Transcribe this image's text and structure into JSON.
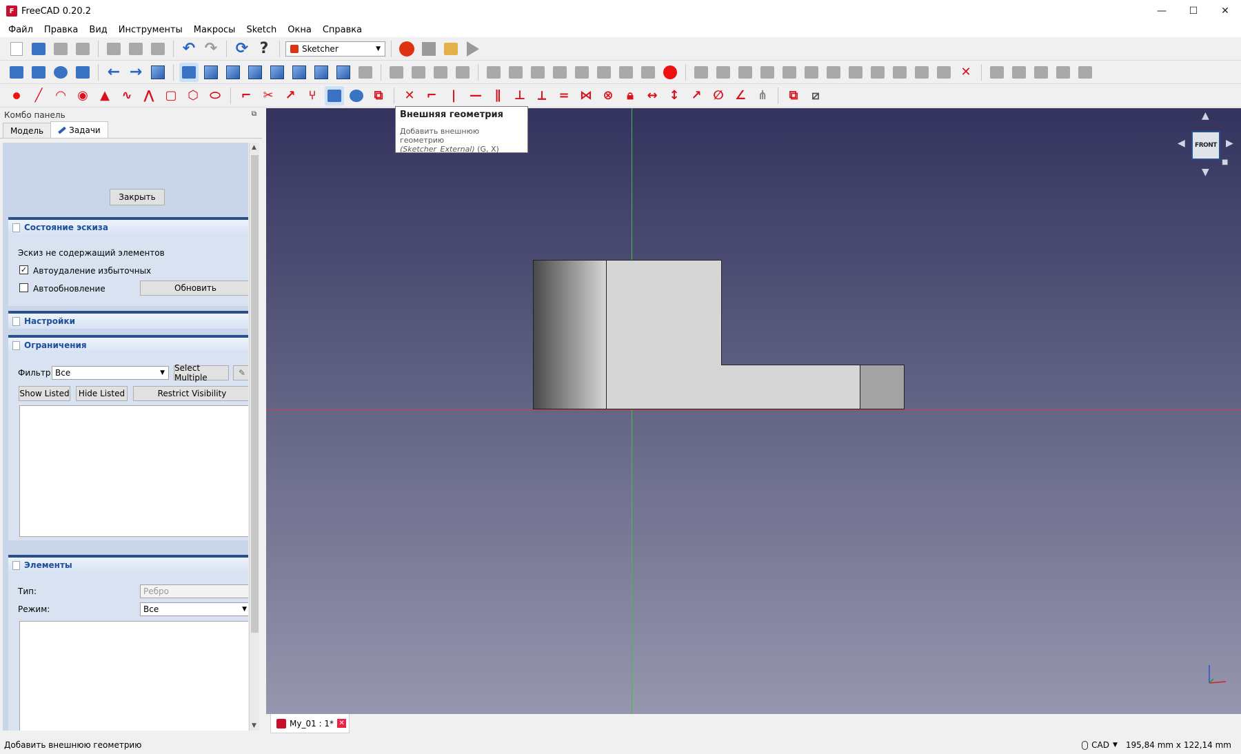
{
  "window": {
    "title": "FreeCAD 0.20.2",
    "minimize": "—",
    "maximize": "☐",
    "close": "✕"
  },
  "menu": [
    "Файл",
    "Правка",
    "Вид",
    "Инструменты",
    "Макросы",
    "Sketch",
    "Окна",
    "Справка"
  ],
  "toolbar": {
    "workbench": "Sketcher"
  },
  "combo": {
    "title": "Комбо панель",
    "tabs": [
      "Модель",
      "Задачи"
    ],
    "close_button": "Закрыть",
    "sketch_state": {
      "header": "Состояние эскиза",
      "status": "Эскиз не содержащий элементов",
      "auto_remove": "Автоудаление избыточных",
      "auto_update": "Автообновление",
      "update_button": "Обновить"
    },
    "settings": {
      "header": "Настройки"
    },
    "constraints": {
      "header": "Ограничения",
      "filter_label": "Фильтр:",
      "filter_value": "Все",
      "select_multiple": "Select Multiple",
      "show_listed": "Show Listed",
      "hide_listed": "Hide Listed",
      "restrict_visibility": "Restrict Visibility"
    },
    "elements": {
      "header": "Элементы",
      "type_label": "Тип:",
      "type_value": "Ребро",
      "mode_label": "Режим:",
      "mode_value": "Все"
    }
  },
  "tooltip": {
    "title": "Внешняя геометрия",
    "text": "Добавить внешнюю геометрию",
    "command": "(Sketcher_External)",
    "shortcut": "(G, X)"
  },
  "navcube": {
    "face": "FRONT"
  },
  "doc_tab": {
    "label": "My_01 : 1*"
  },
  "status": {
    "message": "Добавить внешнюю геометрию",
    "nav_style": "CAD",
    "dimensions": "195,84 mm x 122,14 mm"
  },
  "colors": {
    "accent": "#2a4f8a",
    "sketch_red": "#d9101e",
    "view_top": "#33335e",
    "view_bottom": "#9696ae"
  }
}
